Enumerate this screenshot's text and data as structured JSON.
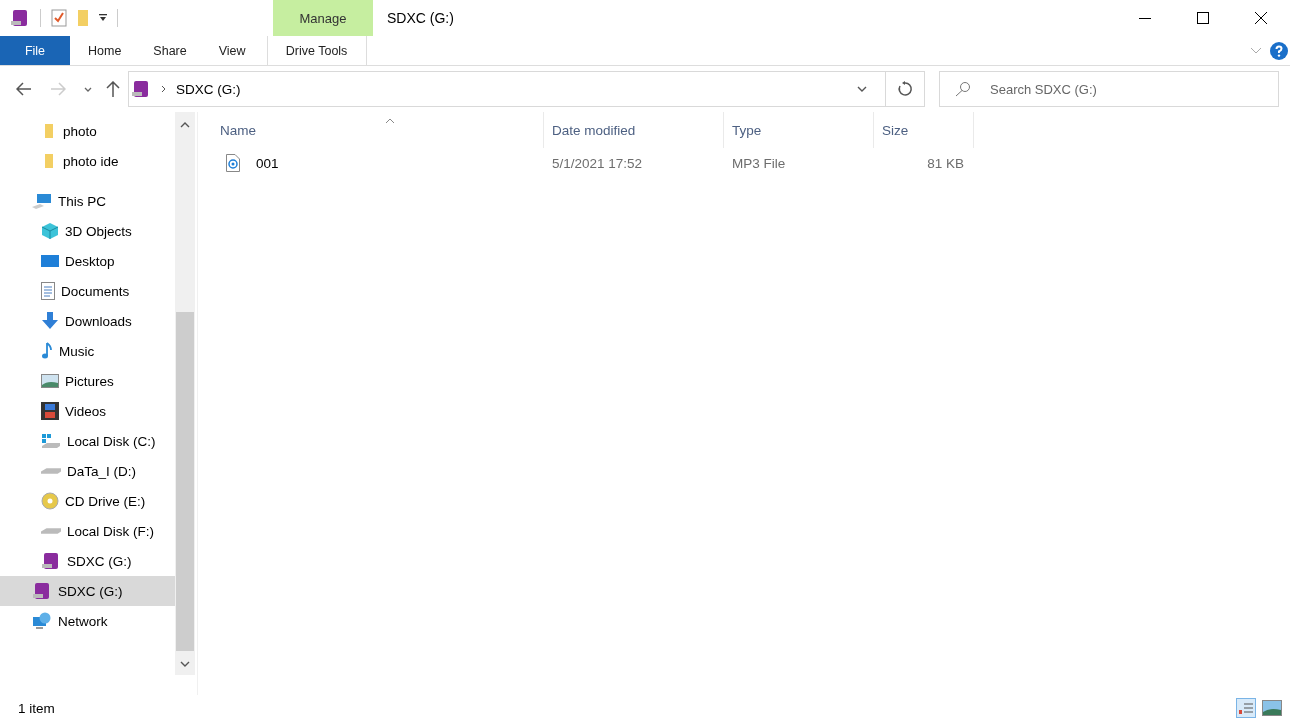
{
  "window": {
    "title": "SDXC (G:)"
  },
  "ribbon": {
    "context_tab": "Manage",
    "tabs": [
      {
        "label": "File",
        "kind": "file",
        "selected": false
      },
      {
        "label": "Home",
        "kind": "tab",
        "selected": false
      },
      {
        "label": "Share",
        "kind": "tab",
        "selected": false
      },
      {
        "label": "View",
        "kind": "tab",
        "selected": false
      },
      {
        "label": "Drive Tools",
        "kind": "context",
        "selected": false
      }
    ]
  },
  "address": {
    "path": "SDXC (G:)"
  },
  "search": {
    "placeholder": "Search SDXC (G:)"
  },
  "sidebar": {
    "pinned": [
      {
        "label": "photo",
        "selected": false
      },
      {
        "label": "photo ide",
        "selected": false
      }
    ],
    "tree": [
      {
        "label": "This PC",
        "kind": "pc",
        "selected": false,
        "children": [
          {
            "label": "3D Objects",
            "kind": "cube",
            "selected": false
          },
          {
            "label": "Desktop",
            "kind": "desktop",
            "selected": false
          },
          {
            "label": "Documents",
            "kind": "documents",
            "selected": false
          },
          {
            "label": "Downloads",
            "kind": "downloads",
            "selected": false
          },
          {
            "label": "Music",
            "kind": "music",
            "selected": false
          },
          {
            "label": "Pictures",
            "kind": "pictures",
            "selected": false
          },
          {
            "label": "Videos",
            "kind": "videos",
            "selected": false
          },
          {
            "label": "Local Disk (C:)",
            "kind": "windisk",
            "selected": false
          },
          {
            "label": "DaTa_I (D:)",
            "kind": "disk",
            "selected": false
          },
          {
            "label": "CD Drive (E:)",
            "kind": "cd",
            "selected": false
          },
          {
            "label": "Local Disk (F:)",
            "kind": "disk",
            "selected": false
          },
          {
            "label": "SDXC (G:)",
            "kind": "sd",
            "selected": false
          }
        ]
      },
      {
        "label": "SDXC (G:)",
        "kind": "sd",
        "selected": true
      },
      {
        "label": "Network",
        "kind": "network",
        "selected": false
      }
    ]
  },
  "table": {
    "columns": [
      "Name",
      "Date modified",
      "Type",
      "Size"
    ],
    "rows": [
      {
        "name": "001",
        "date": "5/1/2021 17:52",
        "type": "MP3 File",
        "size": "81 KB"
      }
    ]
  },
  "status_bar": {
    "count": "1 item"
  }
}
